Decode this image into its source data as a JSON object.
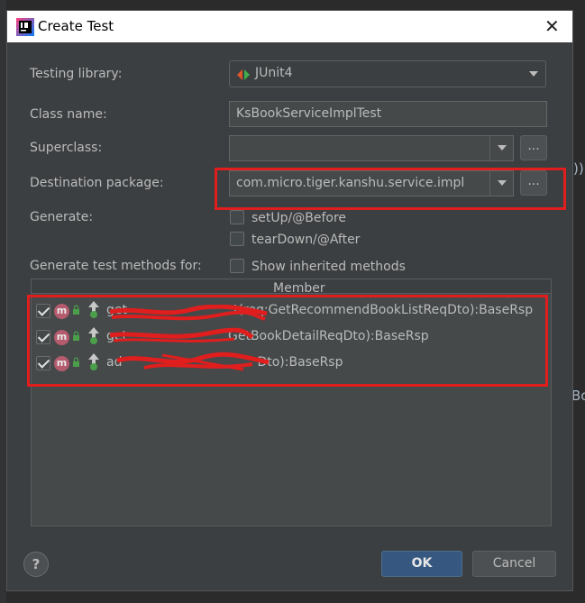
{
  "window": {
    "title": "Create Test",
    "close_label": "✕"
  },
  "form": {
    "testing_library_label": "Testing library:",
    "testing_library_value": "JUnit4",
    "class_name_label": "Class name:",
    "class_name_value": "KsBookServiceImplTest",
    "superclass_label": "Superclass:",
    "superclass_value": "",
    "destination_package_label": "Destination package:",
    "destination_package_value": "com.micro.tiger.kanshu.service.impl",
    "browse_label": "...",
    "generate_label": "Generate:",
    "setup_label": "setUp/@Before",
    "setup_checked": false,
    "teardown_label": "tearDown/@After",
    "teardown_checked": false,
    "methods_label": "Generate test methods for:",
    "show_inherited_label": "Show inherited methods",
    "show_inherited_checked": false
  },
  "table": {
    "header": "Member",
    "rows": [
      {
        "checked": true,
        "badge": "m",
        "text": "get",
        "text_tail": "t(req:GetRecommendBookListReqDto):BaseRsp"
      },
      {
        "checked": true,
        "badge": "m",
        "text": "get",
        "text_tail": "GetBookDetailReqDto):BaseRsp"
      },
      {
        "checked": true,
        "badge": "m",
        "text": "ad",
        "text_tail": "Dto):BaseRsp"
      }
    ]
  },
  "buttons": {
    "help": "?",
    "ok": "OK",
    "cancel": "Cancel"
  },
  "background": {
    "right_fragment": "Bo",
    "paren_fragment": "))"
  },
  "colors": {
    "accent": "#365880",
    "annotation_red": "#e01e1e",
    "method_badge": "#b45b6d"
  },
  "icons": [
    "intellij-icon",
    "junit-icon",
    "close-icon",
    "method-icon",
    "lock-icon",
    "override-arrow-icon",
    "help-icon"
  ]
}
